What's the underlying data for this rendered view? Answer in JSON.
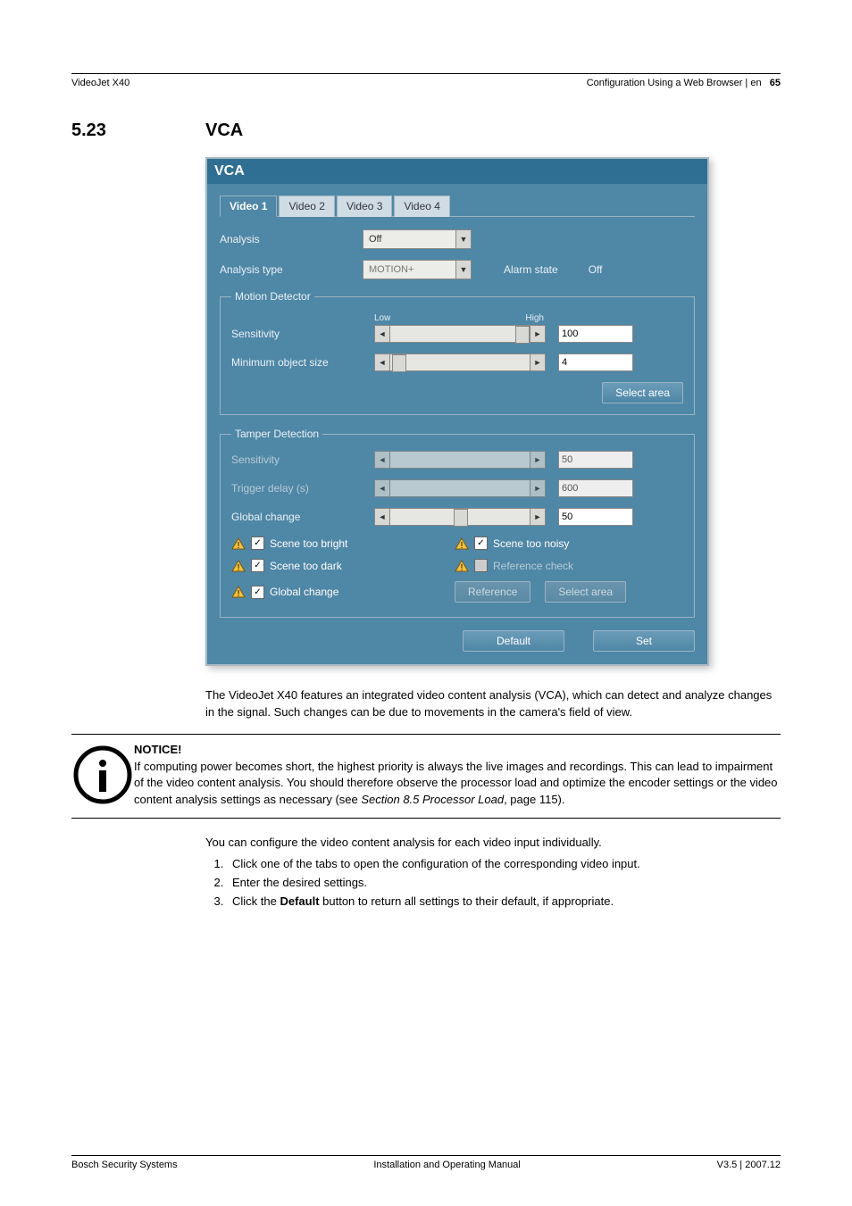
{
  "header": {
    "left": "VideoJet X40",
    "right_prefix": "Configuration Using a Web Browser | en",
    "page_num": "65"
  },
  "section": {
    "num": "5.23",
    "title": "VCA"
  },
  "panel": {
    "title": "VCA",
    "tabs": [
      "Video 1",
      "Video 2",
      "Video 3",
      "Video 4"
    ],
    "active_tab": 0,
    "analysis_label": "Analysis",
    "analysis_value": "Off",
    "analysis_type_label": "Analysis type",
    "analysis_type_value": "MOTION+",
    "alarm_state_label": "Alarm state",
    "alarm_state_value": "Off",
    "motion_group": "Motion Detector",
    "low": "Low",
    "high": "High",
    "sensitivity_label": "Sensitivity",
    "sensitivity_value": "100",
    "min_obj_label": "Minimum object size",
    "min_obj_value": "4",
    "select_area_btn": "Select area",
    "tamper_group": "Tamper Detection",
    "t_sensitivity_label": "Sensitivity",
    "t_sensitivity_value": "50",
    "trigger_delay_label": "Trigger delay (s)",
    "trigger_delay_value": "600",
    "global_change_label": "Global change",
    "global_change_value": "50",
    "cb_scene_bright": "Scene too bright",
    "cb_scene_noisy": "Scene too noisy",
    "cb_scene_dark": "Scene too dark",
    "cb_ref_check": "Reference check",
    "cb_global_change": "Global change",
    "reference_btn": "Reference",
    "t_select_area_btn": "Select area",
    "default_btn": "Default",
    "set_btn": "Set"
  },
  "para1": "The VideoJet X40 features an integrated video content analysis (VCA), which can detect and analyze changes in the signal. Such changes can be due to movements in the camera's field of view.",
  "notice": {
    "heading": "NOTICE!",
    "text_a": "If computing power becomes short, the highest priority is always the live images and recordings. This can lead to impairment of the video content analysis. You should therefore observe the processor load and optimize the encoder settings or the video content analysis settings as necessary (see ",
    "text_ref": "Section 8.5 Processor Load",
    "text_b": ", page 115)."
  },
  "para2": "You can configure the video content analysis for each video input individually.",
  "steps": [
    "Click one of the tabs to open the configuration of the corresponding video input.",
    "Enter the desired settings.",
    {
      "a": "Click the ",
      "b": "Default",
      "c": " button to return all settings to their default, if appropriate."
    }
  ],
  "footer": {
    "left": "Bosch Security Systems",
    "center": "Installation and Operating Manual",
    "right": "V3.5 | 2007.12"
  }
}
